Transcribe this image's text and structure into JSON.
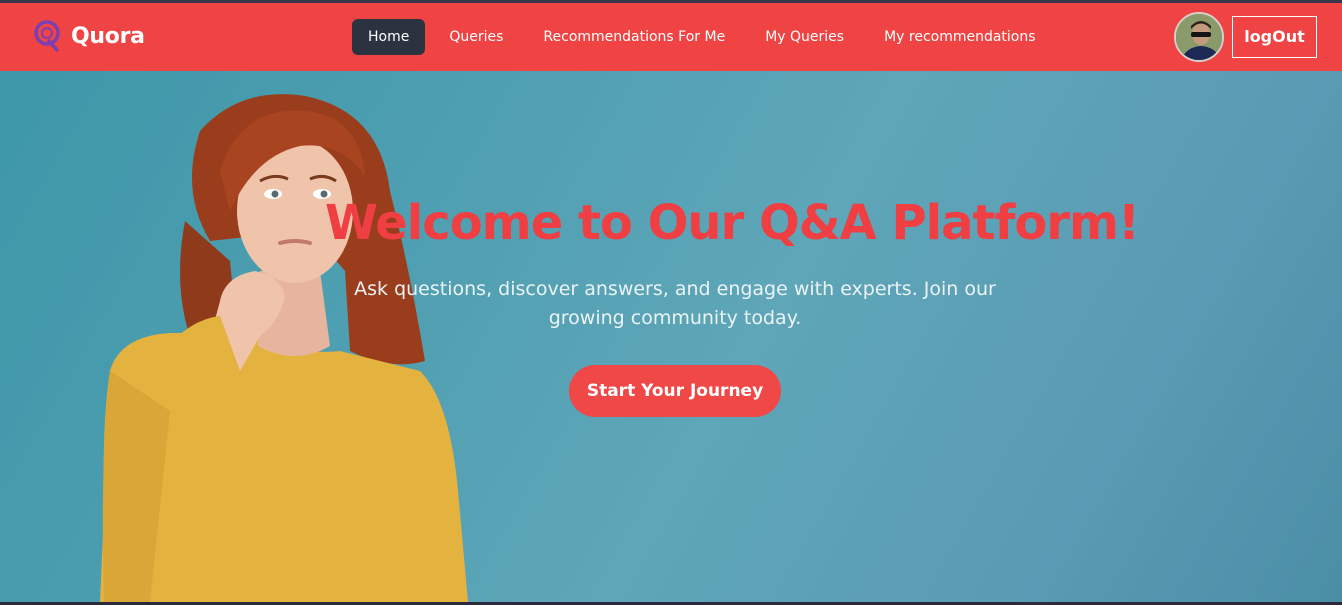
{
  "brand": {
    "name": "Quora",
    "logo_icon": "q-logo-icon",
    "logo_color": "#7b3fb3"
  },
  "nav": {
    "items": [
      {
        "label": "Home",
        "active": true
      },
      {
        "label": "Queries",
        "active": false
      },
      {
        "label": "Recommendations For Me",
        "active": false
      },
      {
        "label": "My Queries",
        "active": false
      },
      {
        "label": "My recommendations",
        "active": false
      }
    ]
  },
  "user": {
    "logout_label": "logOut"
  },
  "hero": {
    "title": "Welcome to Our Q&A Platform!",
    "subtitle": "Ask questions, discover answers, and engage with experts. Join our growing community today.",
    "cta_label": "Start Your Journey"
  },
  "colors": {
    "navbar": "#f04444",
    "active_nav": "#2b3240",
    "hero_title": "#ef3f43",
    "cta": "#f04747",
    "hero_bg": "#5ea6b8"
  }
}
